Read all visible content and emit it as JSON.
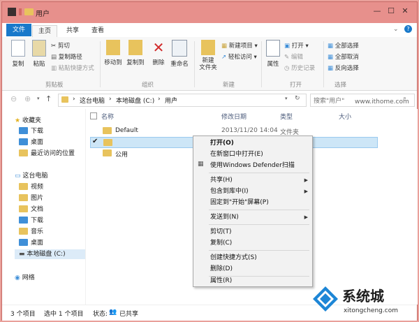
{
  "title": "用户",
  "tabs": [
    "文件",
    "主页",
    "共享",
    "查看"
  ],
  "ribbon": {
    "copy": "复制",
    "paste": "粘贴",
    "cut": "剪切",
    "copy_path": "复制路径",
    "paste_shortcut": "粘贴快捷方式",
    "clipboard": "剪贴板",
    "move_to": "移动到",
    "copy_to": "复制到",
    "delete": "删除",
    "rename": "重命名",
    "organize": "组织",
    "new_folder": "新建\n文件夹",
    "new_item": "新建项目",
    "easy_access": "轻松访问",
    "new": "新建",
    "properties": "属性",
    "open": "打开",
    "edit": "编辑",
    "history": "历史记录",
    "open_group": "打开",
    "select_all": "全部选择",
    "select_none": "全部取消",
    "invert": "反向选择",
    "select_group": "选择"
  },
  "address": {
    "parts": [
      "这台电脑",
      "本地磁盘 (C:)",
      "用户"
    ],
    "search_placeholder": "搜索\"用户\""
  },
  "watermark": "www.ithome.com",
  "nav": {
    "favorites": "收藏夹",
    "downloads": "下载",
    "desktop": "桌面",
    "recent": "最近访问的位置",
    "this_pc": "这台电脑",
    "videos": "视频",
    "pictures": "图片",
    "documents": "文档",
    "downloads2": "下载",
    "music": "音乐",
    "desktop2": "桌面",
    "local_disk": "本地磁盘 (C:)",
    "network": "网络"
  },
  "columns": {
    "name": "名称",
    "date": "修改日期",
    "type": "类型",
    "size": "大小"
  },
  "files": [
    {
      "name": "Default",
      "date": "2013/11/20 14:04",
      "type": "文件夹"
    },
    {
      "name": "",
      "date": "",
      "type": ""
    },
    {
      "name": "公用",
      "date": "",
      "type": ""
    }
  ],
  "context_menu": {
    "open": "打开(O)",
    "open_new": "在新窗口中打开(E)",
    "defender": "使用Windows Defender扫描",
    "share": "共享(H)",
    "include": "包含到库中(I)",
    "pin": "固定到\"开始\"屏幕(P)",
    "send_to": "发送到(N)",
    "cut": "剪切(T)",
    "copy": "复制(C)",
    "shortcut": "创建快捷方式(S)",
    "delete": "删除(D)",
    "properties": "属性(R)"
  },
  "status": {
    "count": "3 个项目",
    "selected": "选中 1 个项目",
    "state_label": "状态:",
    "state": "已共享"
  },
  "logo": {
    "name": "系统城",
    "url": "xitongcheng.com"
  },
  "colors": {
    "accent": "#1979ca",
    "title_bg": "#e7908c"
  }
}
